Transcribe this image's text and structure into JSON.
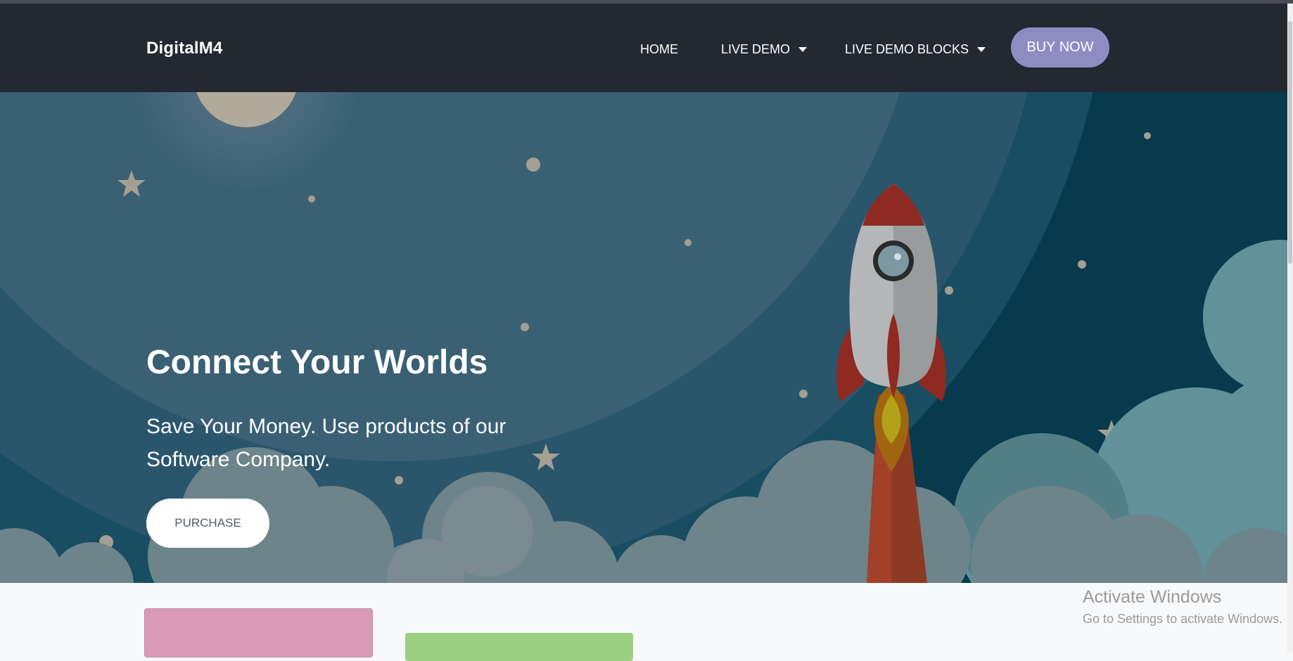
{
  "navbar": {
    "brand": "DigitalM4",
    "items": [
      {
        "label": "HOME",
        "has_dropdown": false
      },
      {
        "label": "LIVE DEMO",
        "has_dropdown": true
      },
      {
        "label": "LIVE DEMO BLOCKS",
        "has_dropdown": true
      }
    ],
    "cta_label": "BUY NOW"
  },
  "hero": {
    "title": "Connect Your Worlds",
    "subtitle": "Save Your Money. Use products of our Software Company.",
    "button_label": "PURCHASE"
  },
  "watermark": {
    "title": "Activate Windows",
    "subtitle": "Go to Settings to activate Windows."
  },
  "colors": {
    "navbar_bg": "#242830",
    "cta_bg": "#8d8dc4",
    "hero_bg": "#063a4c",
    "card_pink": "#d99ab6",
    "card_green": "#9ccf83"
  },
  "icons": [
    "caret-down-icon"
  ]
}
